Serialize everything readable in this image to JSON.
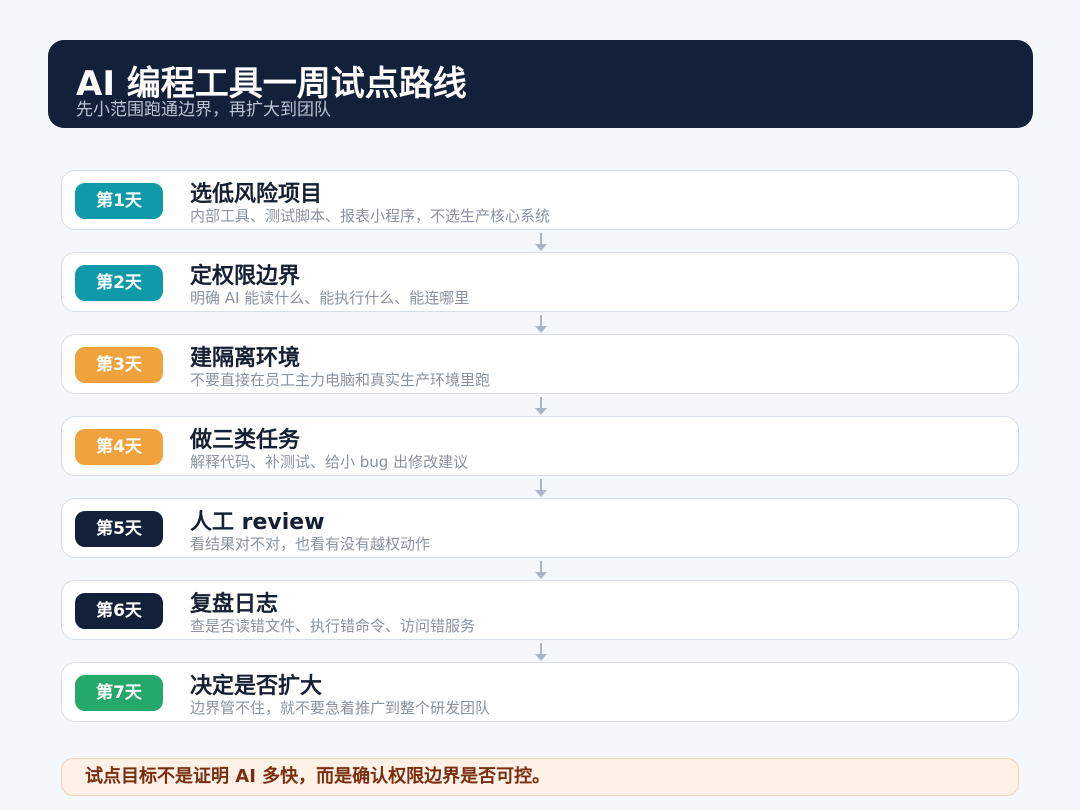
{
  "header": {
    "title": "AI 编程工具一周试点路线",
    "subtitle": "先小范围跑通边界，再扩大到团队"
  },
  "steps": [
    {
      "badge": "第1天",
      "title": "选低风险项目",
      "description": "内部工具、测试脚本、报表小程序，不选生产核心系统",
      "badge_color": "#0f9aa9"
    },
    {
      "badge": "第2天",
      "title": "定权限边界",
      "description": "明确 AI 能读什么、能执行什么、能连哪里",
      "badge_color": "#0f9aa9"
    },
    {
      "badge": "第3天",
      "title": "建隔离环境",
      "description": "不要直接在员工主力电脑和真实生产环境里跑",
      "badge_color": "#f0a23d"
    },
    {
      "badge": "第4天",
      "title": "做三类任务",
      "description": "解释代码、补测试、给小 bug 出修改建议",
      "badge_color": "#f0a23d"
    },
    {
      "badge": "第5天",
      "title": "人工 review",
      "description": "看结果对不对，也看有没有越权动作",
      "badge_color": "#13203a"
    },
    {
      "badge": "第6天",
      "title": "复盘日志",
      "description": "查是否读错文件、执行错命令、访问错服务",
      "badge_color": "#13203a"
    },
    {
      "badge": "第7天",
      "title": "决定是否扩大",
      "description": "边界管不住，就不要急着推广到整个研发团队",
      "badge_color": "#24a96b"
    }
  ],
  "footer": {
    "note": "试点目标不是证明 AI 多快，而是确认权限边界是否可控。"
  },
  "colors": {
    "header_background": "#13203a",
    "page_background": "#f4f7fb",
    "connector": "#aab6c6",
    "footer_background": "#fff1e6"
  }
}
